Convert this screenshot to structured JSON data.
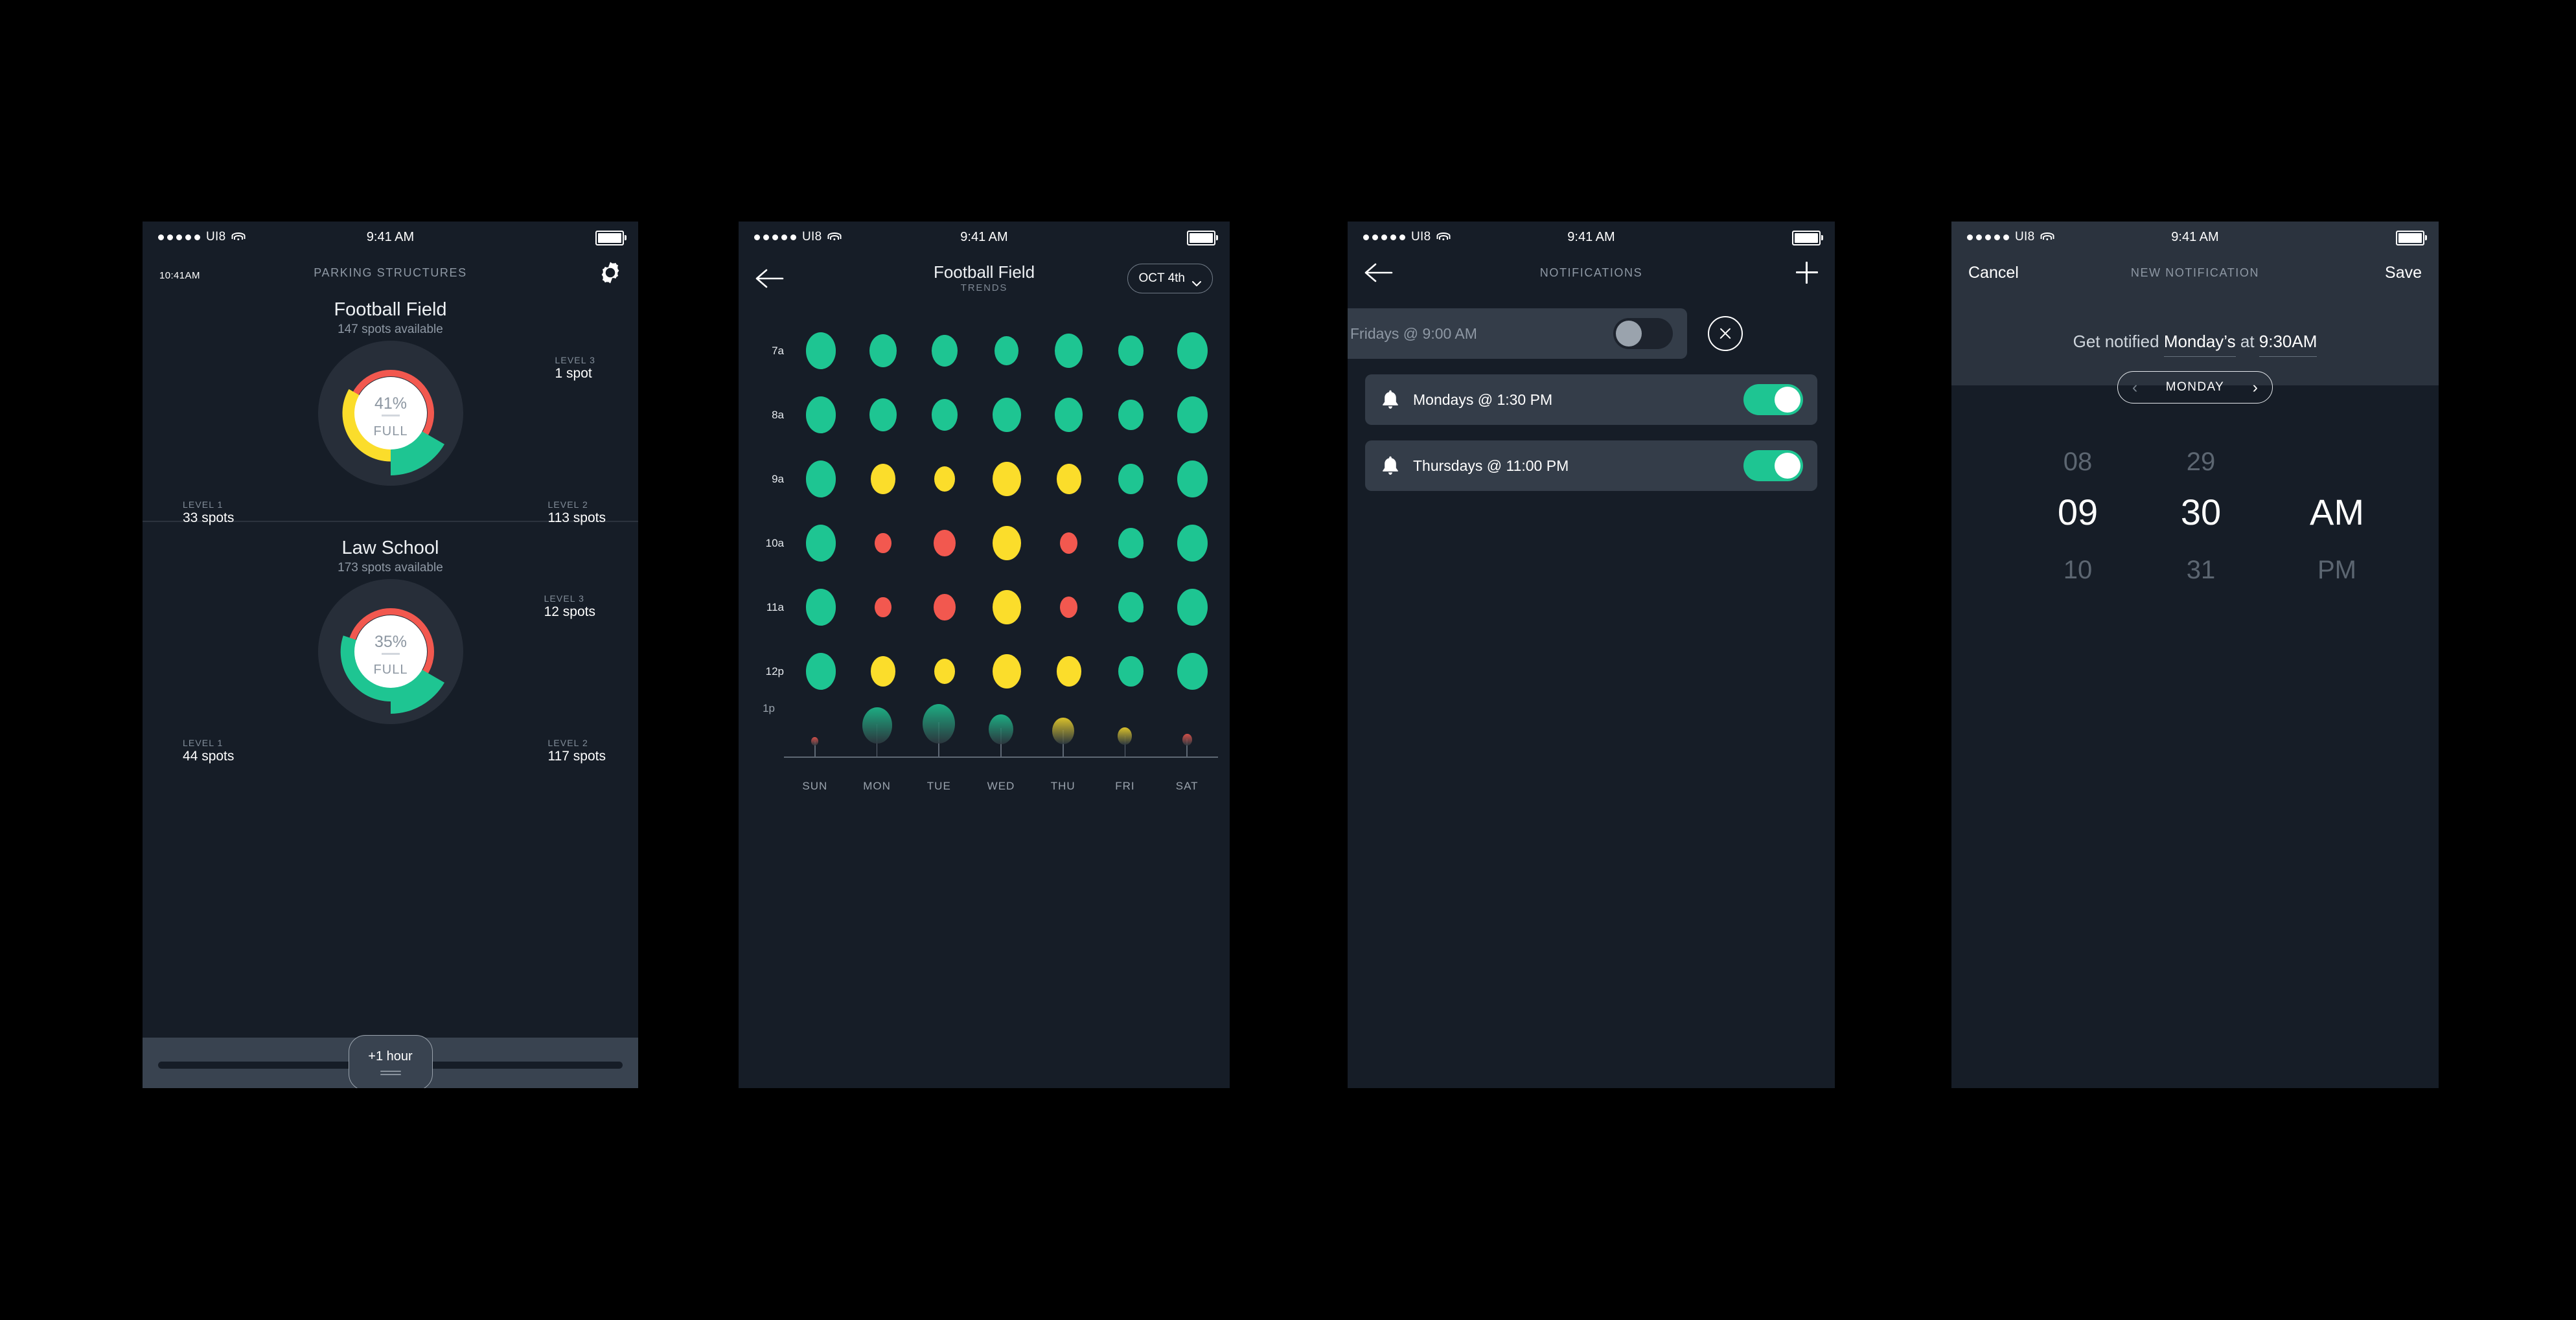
{
  "status_bar": {
    "carrier": "UI8",
    "time": "9:41 AM",
    "signal_dots": 5
  },
  "colors": {
    "teal": "#1ec592",
    "yellow": "#fbdd2b",
    "red": "#f2584f",
    "bg_dark": "#161d27",
    "bg_panel": "#2b333e",
    "bg_card": "#343d49"
  },
  "screen1": {
    "nav": {
      "clock": "10:41",
      "clock_meridiem": "AM",
      "title": "PARKING STRUCTURES",
      "gear_icon": "gear-icon"
    },
    "structures": [
      {
        "name": "Football Field",
        "subtitle": "147 spots available",
        "percent": "41%",
        "state": "FULL",
        "levels": [
          {
            "caption": "LEVEL 3",
            "value": "1 spot"
          },
          {
            "caption": "LEVEL 1",
            "value": "33 spots"
          },
          {
            "caption": "LEVEL 2",
            "value": "113 spots"
          }
        ]
      },
      {
        "name": "Law School",
        "subtitle": "173 spots available",
        "percent": "35%",
        "state": "FULL",
        "levels": [
          {
            "caption": "LEVEL 3",
            "value": "12 spots"
          },
          {
            "caption": "LEVEL 1",
            "value": "44 spots"
          },
          {
            "caption": "LEVEL 2",
            "value": "117 spots"
          }
        ]
      }
    ],
    "slider": {
      "label": "+1 hour"
    }
  },
  "screen2": {
    "nav": {
      "back_icon": "back-arrow-icon",
      "title": "Football Field",
      "subtitle": "TRENDS",
      "date_pill": "OCT 4th",
      "chevron_icon": "chevron-down-icon"
    },
    "chart_data": {
      "type": "heatmap",
      "title": "Football Field Trends",
      "xlabel": "",
      "ylabel": "",
      "legend": "dot size = availability, color = occupancy (teal=open, yellow=busy, red=full)",
      "categories": [
        "SUN",
        "MON",
        "TUE",
        "WED",
        "THU",
        "FRI",
        "SAT"
      ],
      "rows": [
        {
          "time": "7a",
          "sizes": [
            46,
            42,
            40,
            37,
            43,
            39,
            47
          ],
          "colors": [
            "teal",
            "teal",
            "teal",
            "teal",
            "teal",
            "teal",
            "teal"
          ]
        },
        {
          "time": "8a",
          "sizes": [
            46,
            42,
            40,
            44,
            43,
            39,
            47
          ],
          "colors": [
            "teal",
            "teal",
            "teal",
            "teal",
            "teal",
            "teal",
            "teal"
          ]
        },
        {
          "time": "9a",
          "sizes": [
            46,
            38,
            32,
            44,
            38,
            39,
            47
          ],
          "colors": [
            "teal",
            "yellow",
            "yellow",
            "yellow",
            "yellow",
            "teal",
            "teal"
          ]
        },
        {
          "time": "10a",
          "sizes": [
            46,
            26,
            34,
            44,
            27,
            39,
            47
          ],
          "colors": [
            "teal",
            "red",
            "red",
            "yellow",
            "red",
            "teal",
            "teal"
          ]
        },
        {
          "time": "11a",
          "sizes": [
            46,
            26,
            34,
            44,
            27,
            39,
            47
          ],
          "colors": [
            "teal",
            "red",
            "red",
            "yellow",
            "red",
            "teal",
            "teal"
          ]
        },
        {
          "time": "12p",
          "sizes": [
            46,
            38,
            32,
            44,
            38,
            39,
            47
          ],
          "colors": [
            "teal",
            "yellow",
            "yellow",
            "yellow",
            "yellow",
            "teal",
            "teal"
          ]
        },
        {
          "time": "1p",
          "sizes": [
            11,
            46,
            50,
            38,
            34,
            22,
            15
          ],
          "colors": [
            "red",
            "teal",
            "teal",
            "teal",
            "yellow",
            "yellow",
            "red"
          ]
        }
      ]
    }
  },
  "screen3": {
    "nav": {
      "back_icon": "back-arrow-icon",
      "title": "NOTIFICATIONS",
      "add_icon": "plus-icon"
    },
    "swiped_item": {
      "label": "Fridays @ 9:00 AM",
      "toggle": "off",
      "delete_icon": "close-icon"
    },
    "items": [
      {
        "bell_icon": "bell-icon",
        "label": "Mondays @ 1:30 PM",
        "toggle": "on"
      },
      {
        "bell_icon": "bell-icon",
        "label": "Thursdays @ 11:00 PM",
        "toggle": "on"
      }
    ]
  },
  "screen4": {
    "nav": {
      "cancel": "Cancel",
      "title": "NEW NOTIFICATION",
      "save": "Save"
    },
    "sentence": {
      "prefix": "Get notified",
      "day": "Monday’s",
      "mid": "at",
      "time": "9:30AM"
    },
    "day_pill": {
      "prev_icon": "chevron-left-icon",
      "label": "MONDAY",
      "next_icon": "chevron-right-icon"
    },
    "picker": {
      "hours": {
        "prev": "08",
        "selected": "09",
        "next": "10"
      },
      "minutes": {
        "prev": "29",
        "selected": "30",
        "next": "31"
      },
      "meridiem": {
        "selected": "AM",
        "next": "PM"
      }
    }
  }
}
